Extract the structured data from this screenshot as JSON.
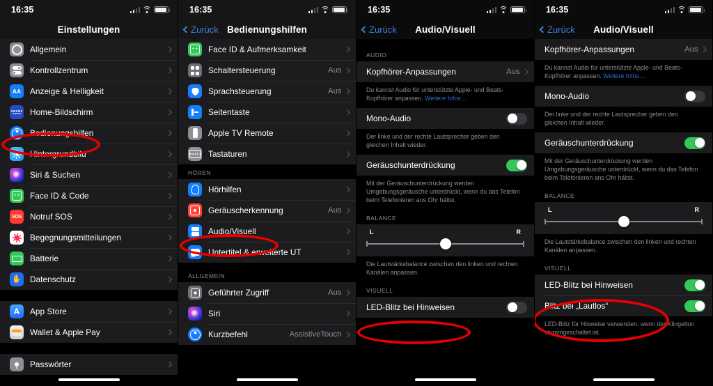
{
  "statusbar": {
    "time": "16:35"
  },
  "panels": [
    {
      "id": "settings",
      "title": "Einstellungen",
      "groups": [
        {
          "rows": [
            {
              "label": "Allgemein",
              "icon": "gear-icon",
              "glyph": "g-gear",
              "type": "chevron"
            },
            {
              "label": "Kontrollzentrum",
              "icon": "control-center-icon",
              "glyph": "g-cc",
              "type": "chevron"
            },
            {
              "label": "Anzeige & Helligkeit",
              "icon": "display-brightness-icon",
              "glyph": "g-aa",
              "text": "AA",
              "type": "chevron"
            },
            {
              "label": "Home-Bildschirm",
              "icon": "home-screen-icon",
              "glyph": "g-home",
              "type": "chevron"
            },
            {
              "label": "Bedienungshilfen",
              "icon": "accessibility-icon",
              "glyph": "g-acc",
              "type": "chevron"
            },
            {
              "label": "Hintergrundbild",
              "icon": "wallpaper-icon",
              "glyph": "g-wall",
              "type": "chevron"
            },
            {
              "label": "Siri & Suchen",
              "icon": "siri-icon",
              "glyph": "g-siri",
              "type": "chevron"
            },
            {
              "label": "Face ID & Code",
              "icon": "face-id-icon",
              "glyph": "g-face",
              "type": "chevron"
            },
            {
              "label": "Notruf SOS",
              "icon": "sos-icon",
              "glyph": "g-sos",
              "text": "SOS",
              "type": "chevron"
            },
            {
              "label": "Begegnungsmitteilungen",
              "icon": "exposure-notifications-icon",
              "glyph": "g-exp",
              "type": "chevron"
            },
            {
              "label": "Batterie",
              "icon": "battery-icon",
              "glyph": "g-batt",
              "type": "chevron"
            },
            {
              "label": "Datenschutz",
              "icon": "privacy-hand-icon",
              "glyph": "g-priv",
              "type": "chevron"
            }
          ]
        },
        {
          "rows": [
            {
              "label": "App Store",
              "icon": "app-store-icon",
              "glyph": "g-appstore",
              "type": "chevron"
            },
            {
              "label": "Wallet & Apple Pay",
              "icon": "wallet-icon",
              "glyph": "g-walletp",
              "type": "chevron"
            }
          ]
        },
        {
          "rows": [
            {
              "label": "Passwörter",
              "icon": "passwords-icon",
              "glyph": "g-pass",
              "type": "chevron"
            }
          ]
        }
      ]
    },
    {
      "id": "accessibility",
      "title": "Bedienungshilfen",
      "back": "Zurück",
      "groups": [
        {
          "rows": [
            {
              "label": "Face ID & Aufmerksamkeit",
              "icon": "face-id-icon",
              "glyph": "g-face",
              "type": "chevron"
            },
            {
              "label": "Schaltersteuerung",
              "icon": "switch-control-icon",
              "glyph": "g-switch",
              "value": "Aus",
              "type": "chevron"
            },
            {
              "label": "Sprachsteuerung",
              "icon": "voice-control-icon",
              "glyph": "g-voice",
              "value": "Aus",
              "type": "chevron"
            },
            {
              "label": "Seitentaste",
              "icon": "side-button-icon",
              "glyph": "g-side",
              "type": "chevron"
            },
            {
              "label": "Apple TV Remote",
              "icon": "apple-tv-remote-icon",
              "glyph": "g-tvr",
              "type": "chevron"
            },
            {
              "label": "Tastaturen",
              "icon": "keyboard-icon",
              "glyph": "g-kbd",
              "type": "chevron"
            }
          ]
        },
        {
          "header": "HÖREN",
          "rows": [
            {
              "label": "Hörhilfen",
              "icon": "hearing-devices-icon",
              "glyph": "g-hear",
              "type": "chevron"
            },
            {
              "label": "Geräuscherkennung",
              "icon": "sound-recognition-icon",
              "glyph": "g-sound",
              "value": "Aus",
              "type": "chevron"
            },
            {
              "label": "Audio/Visuell",
              "icon": "audio-visual-icon",
              "glyph": "g-av",
              "type": "chevron"
            },
            {
              "label": "Untertitel & erweiterte UT",
              "icon": "captions-icon",
              "glyph": "g-cap",
              "type": "chevron"
            }
          ]
        },
        {
          "header": "ALLGEMEIN",
          "rows": [
            {
              "label": "Geführter Zugriff",
              "icon": "guided-access-icon",
              "glyph": "g-guided",
              "value": "Aus",
              "type": "chevron"
            },
            {
              "label": "Siri",
              "icon": "siri-icon",
              "glyph": "g-siri",
              "type": "chevron"
            },
            {
              "label": "Kurzbefehl",
              "icon": "accessibility-icon",
              "glyph": "g-acc",
              "value": "AssistiveTouch",
              "type": "chevron"
            }
          ]
        }
      ]
    },
    {
      "id": "audiovisual-top",
      "title": "Audio/Visuell",
      "back": "Zurück",
      "sections": {
        "audio_header": "AUDIO",
        "headphone_label": "Kopfhörer-Anpassungen",
        "headphone_value": "Aus",
        "headphone_note": "Du kannst Audio für unterstützte Apple- und Beats-Kopfhörer anpassen.",
        "headphone_link": "Weitere Infos ...",
        "mono_label": "Mono-Audio",
        "mono_state": "off",
        "mono_note": "Der linke und der rechte Lautsprecher geben den gleichen Inhalt wieder.",
        "noise_label": "Geräuschunterdrückung",
        "noise_state": "on",
        "noise_note": "Mit der Geräuschunterdrückung werden Umgebungsgeräusche unterdrückt, wenn du das Telefon beim Telefonieren ans Ohr hältst.",
        "balance_header": "BALANCE",
        "balance_left": "L",
        "balance_right": "R",
        "balance_note": "Die Lautstärkebalance zwischen den linken und rechten Kanälen anpassen.",
        "visual_header": "VISUELL",
        "led_label": "LED-Blitz bei Hinweisen",
        "led_state": "off"
      }
    },
    {
      "id": "audiovisual-scrolled",
      "title": "Audio/Visuell",
      "back": "Zurück",
      "sections": {
        "headphone_label": "Kopfhörer-Anpassungen",
        "headphone_value": "Aus",
        "headphone_note": "Du kannst Audio für unterstützte Apple- und Beats-Kopfhörer anpassen.",
        "headphone_link": "Weitere Infos ...",
        "mono_label": "Mono-Audio",
        "mono_state": "off",
        "mono_note": "Der linke und der rechte Lautsprecher geben den gleichen Inhalt wieder.",
        "noise_label": "Geräuschunterdrückung",
        "noise_state": "on",
        "noise_note": "Mit der Geräuschunterdrückung werden Umgebungsgeräusche unterdrückt, wenn du das Telefon beim Telefonieren ans Ohr hältst.",
        "balance_header": "BALANCE",
        "balance_left": "L",
        "balance_right": "R",
        "balance_note": "Die Lautstärkebalance zwischen den linken und rechten Kanälen anpassen.",
        "visual_header": "VISUELL",
        "led_label": "LED-Blitz bei Hinweisen",
        "led_state": "on",
        "silent_label": "Blitz bei „Lautlos“",
        "silent_state": "on",
        "visual_note": "LED-Blitz für Hinweise verwenden, wenn der Klingelton stummgeschaltet ist."
      }
    }
  ],
  "annotations": {
    "color": "#e60000"
  }
}
